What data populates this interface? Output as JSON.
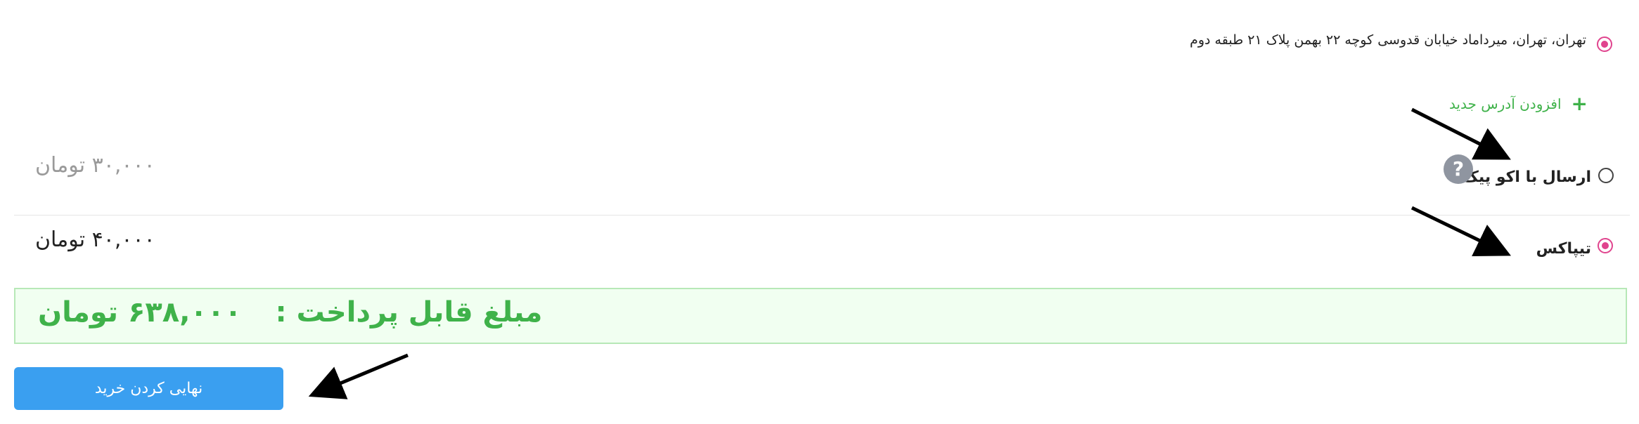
{
  "address": {
    "text": "تهران، تهران، میرداماد خیابان قدوسی کوچه ۲۲ بهمن پلاک ۲۱ طبقه دوم",
    "selected": true
  },
  "add_address": {
    "icon": "plus-icon",
    "label": "افزودن آدرس جدید"
  },
  "shipping_options": [
    {
      "label": "ارسال با اکو پیک",
      "price": "۳۰,۰۰۰ تومان",
      "selected": false,
      "help_icon": "?"
    },
    {
      "label": "تیپاکس",
      "price": "۴۰,۰۰۰ تومان",
      "selected": true
    }
  ],
  "total": {
    "label": "مبلغ قابل پرداخت :",
    "amount": "۶۳۸,۰۰۰ تومان"
  },
  "checkout_button": {
    "label": "نهایی کردن خرید"
  },
  "colors": {
    "accent_pink": "#e0448e",
    "green": "#3fb24a",
    "button_blue": "#3a9ff0",
    "total_bg": "#f1fff1"
  }
}
